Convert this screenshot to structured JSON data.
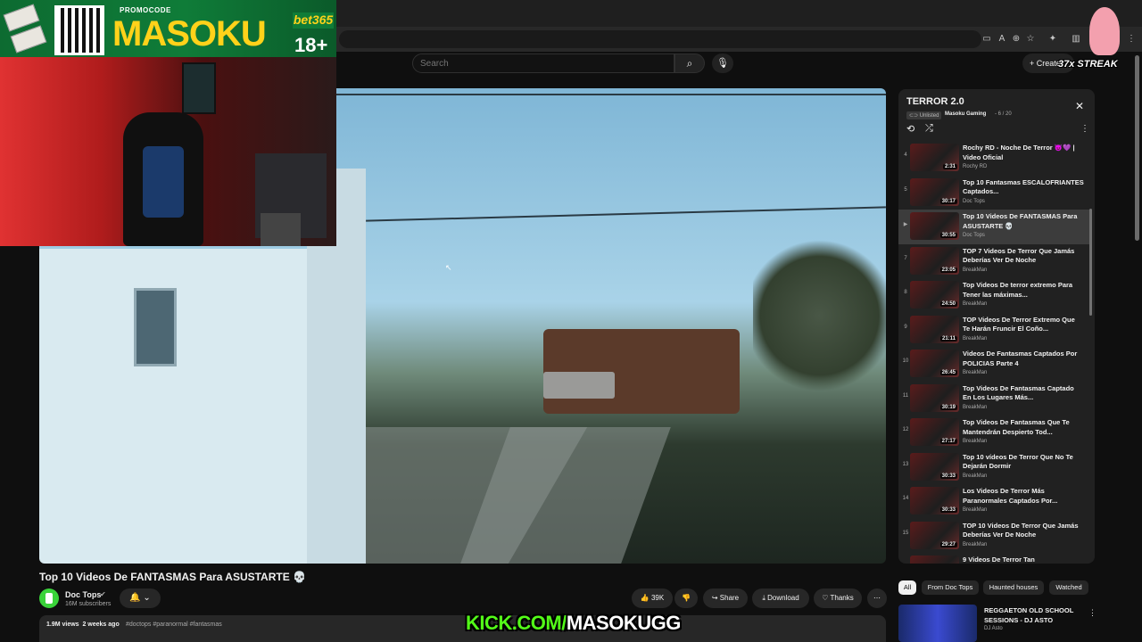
{
  "promo": {
    "label": "PROMOCODE",
    "code": "MASOKU",
    "brand": "bet365",
    "age": "18+"
  },
  "streak": "37x STREAK",
  "header": {
    "search_placeholder": "Search",
    "create_label": "Create"
  },
  "video": {
    "title": "Top 10 Videos De FANTASMAS Para ASUSTARTE 💀",
    "channel": "Doc Tops",
    "subscribers": "16M subscribers",
    "views": "1.9M views",
    "age": "2 weeks ago",
    "tags": "#doctops #paranormal #fantasmas"
  },
  "actions": {
    "likes": "39K",
    "share": "Share",
    "download": "Download",
    "thanks": "Thanks",
    "more": "⋯"
  },
  "overlay_text": {
    "kick_green": "KICK.COM/",
    "kick_white": "MASOKUGG"
  },
  "playlist": {
    "title": "TERROR 2.0",
    "status": "Unlisted",
    "owner": "Masoku Gaming",
    "position": "- 6 / 20",
    "items": [
      {
        "idx": "4",
        "title": "Rochy RD - Noche De Terror 😈💜 | Video Oficial",
        "channel": "Rochy RD",
        "duration": "2:31"
      },
      {
        "idx": "5",
        "title": "Top 10 Fantasmas ESCALOFRIANTES Captados...",
        "channel": "Doc Tops",
        "duration": "30:17"
      },
      {
        "idx": "▶",
        "title": "Top 10 Videos De FANTASMAS Para ASUSTARTE 💀",
        "channel": "Doc Tops",
        "duration": "30:55"
      },
      {
        "idx": "7",
        "title": "TOP 7 Videos De Terror Que Jamás Deberías Ver De Noche",
        "channel": "BreakMan",
        "duration": "23:05"
      },
      {
        "idx": "8",
        "title": "Top Videos De terror extremo Para Tener las máximas...",
        "channel": "BreakMan",
        "duration": "24:50"
      },
      {
        "idx": "9",
        "title": "TOP Videos De Terror Extremo Que Te Harán Fruncir El Coño...",
        "channel": "BreakMan",
        "duration": "21:11"
      },
      {
        "idx": "10",
        "title": "Videos De Fantasmas Captados Por POLICIAS Parte 4",
        "channel": "BreakMan",
        "duration": "26:45"
      },
      {
        "idx": "11",
        "title": "Top Videos De Fantasmas Captado En Los Lugares Más...",
        "channel": "BreakMan",
        "duration": "30:19"
      },
      {
        "idx": "12",
        "title": "Top Videos De Fantasmas Que Te Mantendrán Despierto Tod...",
        "channel": "BreakMan",
        "duration": "27:17"
      },
      {
        "idx": "13",
        "title": "Top 10 vídeos De Terror Que No Te Dejarán Dormir",
        "channel": "BreakMan",
        "duration": "30:33"
      },
      {
        "idx": "14",
        "title": "Los Videos De Terror Más Paranormales Captados Por...",
        "channel": "BreakMan",
        "duration": "30:33"
      },
      {
        "idx": "15",
        "title": "TOP 10 Videos De Terror Que Jamás Deberías Ver De Noche",
        "channel": "BreakMan",
        "duration": "29:27"
      },
      {
        "idx": "16",
        "title": "9 Videos De Terror Tan",
        "channel": "",
        "duration": ""
      }
    ]
  },
  "chips": [
    "All",
    "From Doc Tops",
    "Haunted houses",
    "Watched"
  ],
  "recommendation": {
    "title": "REGGAETON OLD SCHOOL SESSIONS - DJ ASTO",
    "channel": "DJ Asto"
  },
  "colors": {
    "kick_green": "#53fc18",
    "promo_yellow": "#ffd21a",
    "bet365_green": "#0f7c38",
    "background": "#0f0f0f"
  }
}
